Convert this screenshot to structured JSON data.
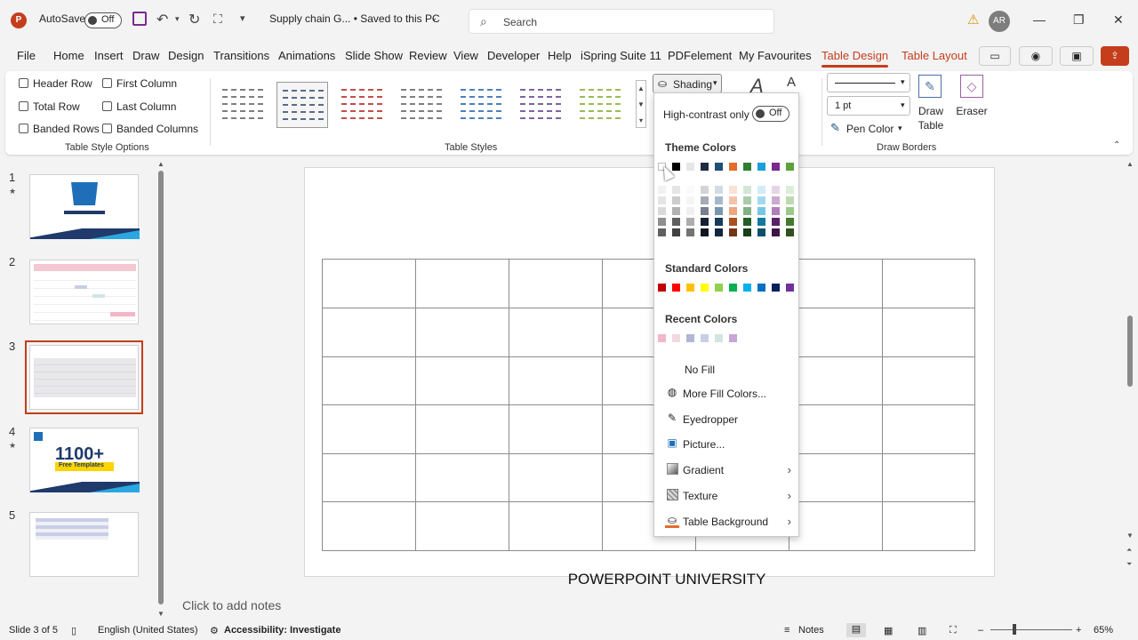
{
  "titlebar": {
    "autosave_label": "AutoSave",
    "autosave_state": "Off",
    "doc_title": "Supply chain G... • Saved to this PC",
    "search_placeholder": "Search",
    "avatar_initials": "AR"
  },
  "menu": [
    "File",
    "Home",
    "Insert",
    "Draw",
    "Design",
    "Transitions",
    "Animations",
    "Slide Show",
    "Review",
    "View",
    "Developer",
    "Help",
    "iSpring Suite 11",
    "PDFelement",
    "My Favourites",
    "Table Design",
    "Table Layout"
  ],
  "ribbon": {
    "style_options": {
      "header_row": "Header Row",
      "first_column": "First Column",
      "total_row": "Total Row",
      "last_column": "Last Column",
      "banded_rows": "Banded Rows",
      "banded_columns": "Banded Columns",
      "group_label": "Table Style Options"
    },
    "table_styles_label": "Table Styles",
    "shading_label": "Shading",
    "pen_weight": "1 pt",
    "pen_color": "Pen Color",
    "draw_table": [
      "Draw",
      "Table"
    ],
    "eraser": "Eraser",
    "draw_borders_label": "Draw Borders"
  },
  "thumb_style_colors": [
    "#7f7f7f",
    "#5a6b8c",
    "#c0504d",
    "#7f7f7f",
    "#4f81bd",
    "#8064a2",
    "#9bbb59"
  ],
  "slides": [
    {
      "num": "1",
      "star": true
    },
    {
      "num": "2",
      "star": false
    },
    {
      "num": "3",
      "star": false
    },
    {
      "num": "4",
      "star": true,
      "big_text": "1100+",
      "sub_text": "Free Templates"
    },
    {
      "num": "5",
      "star": false
    }
  ],
  "slide_caption": "POWERPOINT UNIVERSITY",
  "notes_placeholder": "Click to add notes",
  "status": {
    "slide_of": "Slide 3 of 5",
    "language": "English (United States)",
    "accessibility": "Accessibility: Investigate",
    "notes": "Notes",
    "zoom": "65%"
  },
  "dropdown": {
    "high_contrast_label": "High-contrast only",
    "high_contrast_state": "Off",
    "theme_colors_label": "Theme Colors",
    "theme_top": [
      "#ffffff",
      "#000000",
      "#e7e6e6",
      "#1f2a44",
      "#1f4e79",
      "#e46c2a",
      "#2e7d32",
      "#1aa0d8",
      "#7b2a8c",
      "#5aa33a"
    ],
    "standard_colors_label": "Standard Colors",
    "standard": [
      "#c00000",
      "#ff0000",
      "#ffc000",
      "#ffff00",
      "#92d050",
      "#00b050",
      "#00b0f0",
      "#0070c0",
      "#002060",
      "#7030a0"
    ],
    "recent_colors_label": "Recent Colors",
    "recent": [
      "#f4b6c8",
      "#f2d9e0",
      "#b4b6d8",
      "#c9cee6",
      "#cfe6e2",
      "#c8a6d6"
    ],
    "no_fill": "No Fill",
    "more_fill": "More Fill Colors...",
    "eyedropper": "Eyedropper",
    "picture": "Picture...",
    "gradient": "Gradient",
    "texture": "Texture",
    "table_background": "Table Background"
  }
}
